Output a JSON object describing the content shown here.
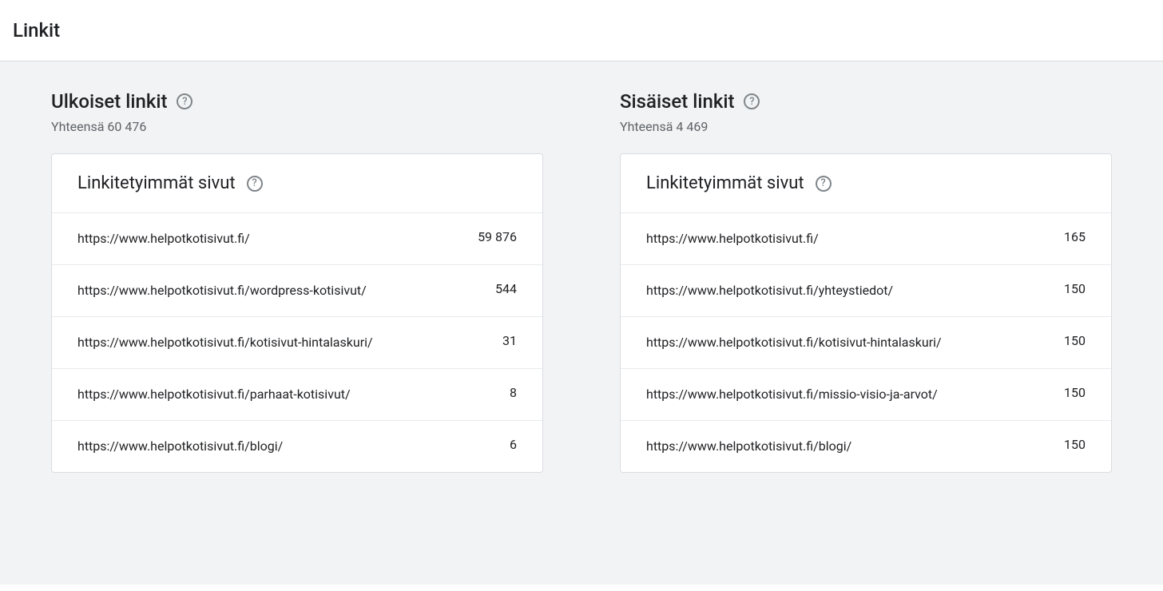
{
  "page_title": "Linkit",
  "external": {
    "title": "Ulkoiset linkit",
    "subtitle": "Yhteensä 60 476",
    "card_title": "Linkitetyimmät sivut",
    "rows": [
      {
        "url": "https://www.helpotkotisivut.fi/",
        "count": "59 876"
      },
      {
        "url": "https://www.helpotkotisivut.fi/wordpress-kotisivut/",
        "count": "544"
      },
      {
        "url": "https://www.helpotkotisivut.fi/kotisivut-hintalaskuri/",
        "count": "31"
      },
      {
        "url": "https://www.helpotkotisivut.fi/parhaat-kotisivut/",
        "count": "8"
      },
      {
        "url": "https://www.helpotkotisivut.fi/blogi/",
        "count": "6"
      }
    ]
  },
  "internal": {
    "title": "Sisäiset linkit",
    "subtitle": "Yhteensä 4 469",
    "card_title": "Linkitetyimmät sivut",
    "rows": [
      {
        "url": "https://www.helpotkotisivut.fi/",
        "count": "165"
      },
      {
        "url": "https://www.helpotkotisivut.fi/yhteystiedot/",
        "count": "150"
      },
      {
        "url": "https://www.helpotkotisivut.fi/kotisivut-hintalaskuri/",
        "count": "150"
      },
      {
        "url": "https://www.helpotkotisivut.fi/missio-visio-ja-arvot/",
        "count": "150"
      },
      {
        "url": "https://www.helpotkotisivut.fi/blogi/",
        "count": "150"
      }
    ]
  }
}
